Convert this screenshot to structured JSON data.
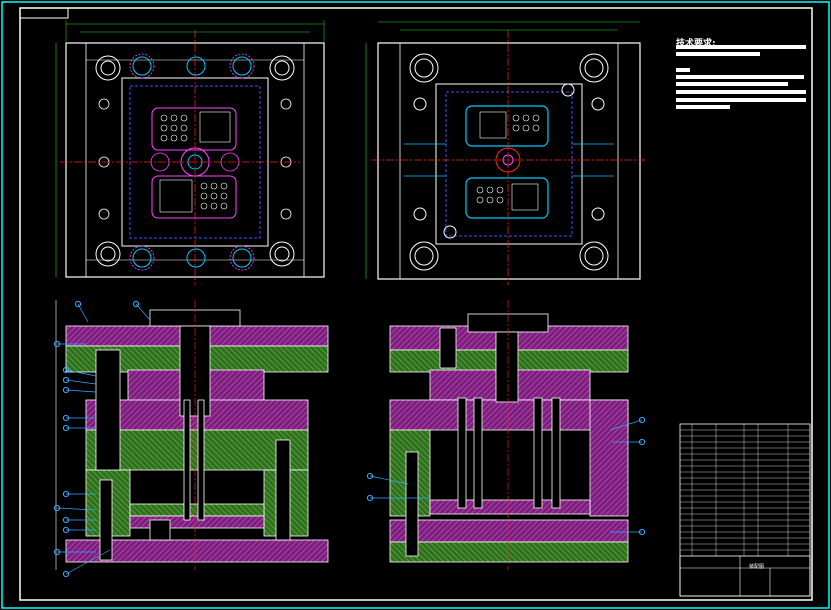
{
  "drawing": {
    "notes_title": "技术要求:",
    "title_block_name": "装配图"
  },
  "colors": {
    "background": "#000000",
    "border": "#00ffff",
    "frame_white": "#ffffff",
    "magenta_hatch": "#9b2c9b",
    "green_hatch": "#3f8a2a",
    "dim_green": "#22dd22",
    "centerline_red": "#ff2222",
    "hidden_blue": "#3355ff",
    "part_cyan": "#00c8ff",
    "leader_blue": "#33aaff"
  }
}
